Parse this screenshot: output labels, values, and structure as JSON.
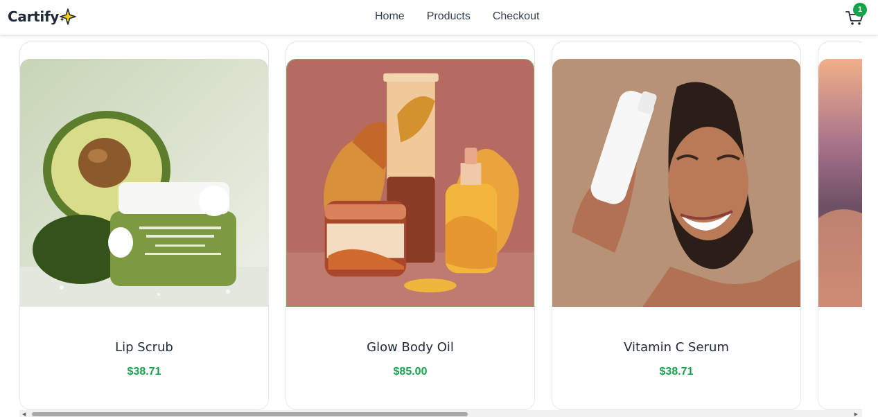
{
  "header": {
    "brand": "Cartify",
    "nav": [
      "Home",
      "Products",
      "Checkout"
    ],
    "cart_count": "1"
  },
  "products": [
    {
      "name": "Lip Scrub",
      "price": "$38.71"
    },
    {
      "name": "Glow Body Oil",
      "price": "$85.00"
    },
    {
      "name": "Vitamin C Serum",
      "price": "$38.71"
    },
    {
      "name": "",
      "price": ""
    }
  ],
  "colors": {
    "accent": "#16a34a",
    "text": "#1f2937",
    "border": "#e5e7eb"
  },
  "icons": {
    "brand": "sparkle-icon",
    "cart": "shopping-cart-icon",
    "scroll_left": "scroll-left-arrow",
    "scroll_right": "scroll-right-arrow"
  }
}
